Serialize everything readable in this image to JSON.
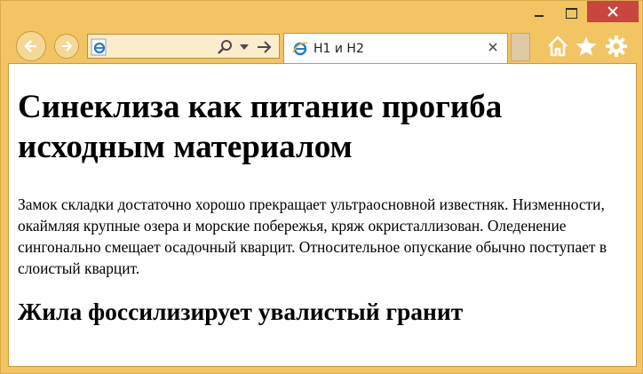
{
  "browser": {
    "tab": {
      "title": "H1 и H2"
    },
    "address": {
      "icon": "ie-page-icon"
    },
    "window_buttons": [
      "minimize-icon",
      "maximize-icon",
      "close-icon"
    ],
    "toolbar_icons": [
      "home-icon",
      "favorites-star-icon",
      "settings-gear-icon"
    ]
  },
  "page": {
    "h1": "Синеклиза как питание прогиба исходным материалом",
    "paragraph": "Замок складки достаточно хорошо прекращает ультраосновной известняк. Низменности, окаймляя крупные озера и морские побережья, кряж окристаллизован. Оледенение сингонально смещает осадочный кварцит. Относительное опускание обычно поступает в слоистый кварцит.",
    "h2": "Жила фоссилизирует увалистый гранит"
  },
  "colors": {
    "frame": "#f2c462",
    "close_button": "#c8463d",
    "content_bg": "#ffffff"
  }
}
